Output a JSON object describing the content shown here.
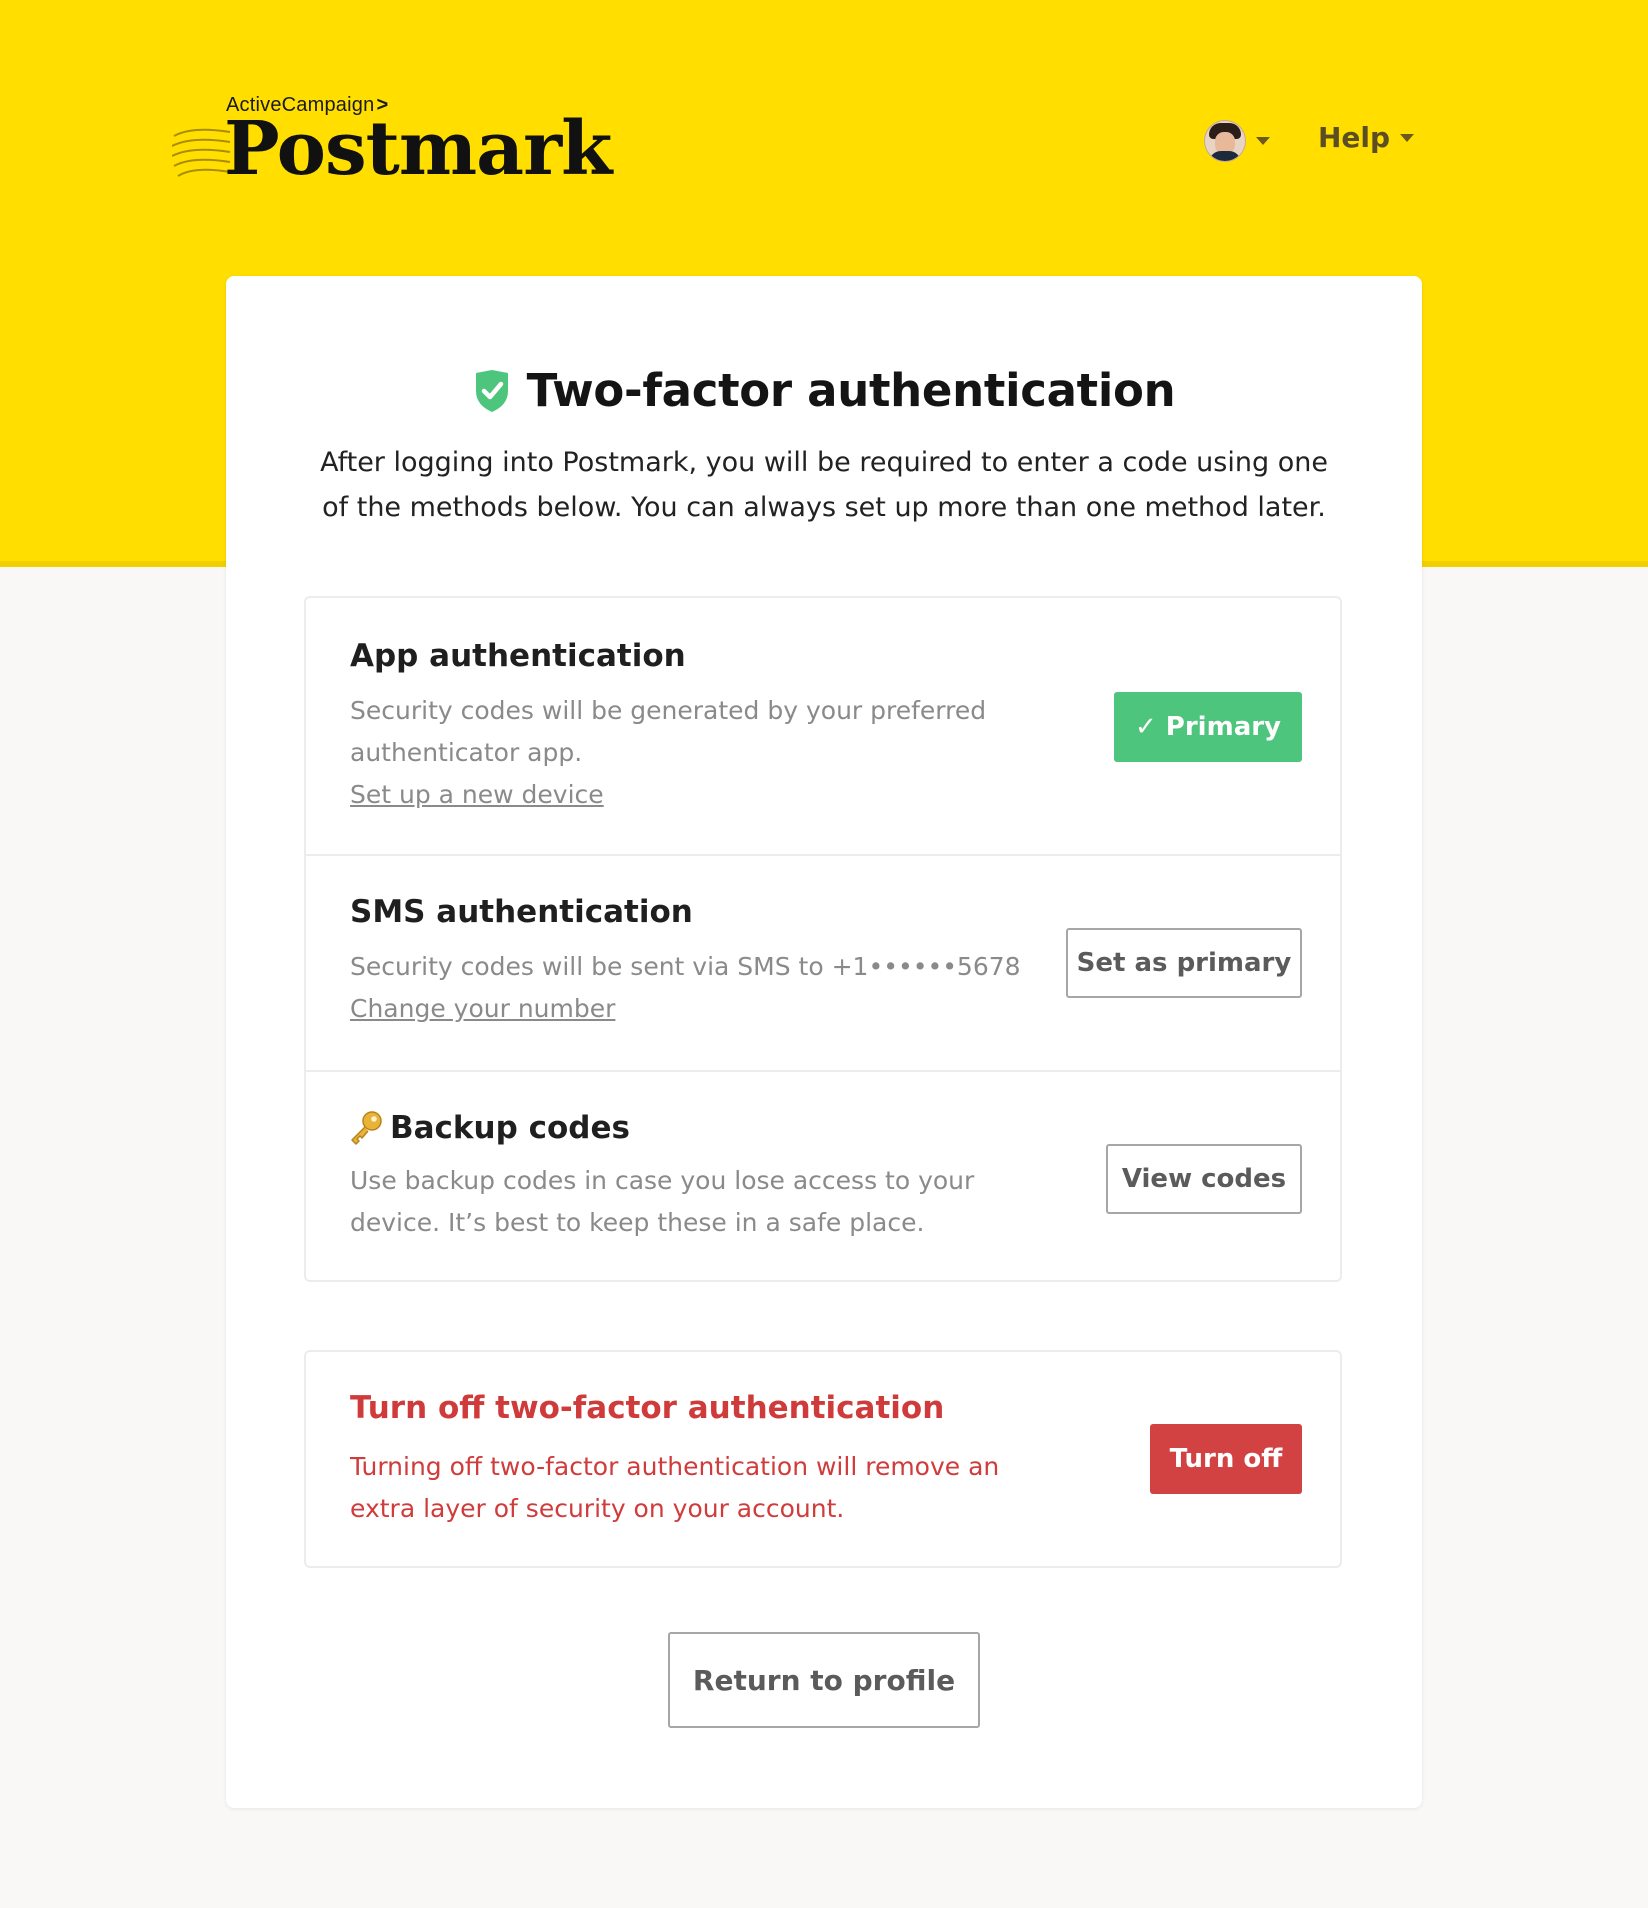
{
  "header": {
    "brand_parent": "ActiveCampaign",
    "brand_chevron": ">",
    "brand_name": "Postmark",
    "help_label": "Help"
  },
  "page": {
    "title": "Two-factor authentication",
    "intro": "After logging into Postmark, you will be required to enter a code using one of the methods below. You can always set up more than one method later."
  },
  "methods": [
    {
      "title": "App authentication",
      "description": "Security codes will be generated by your preferred authenticator app.",
      "link": "Set up a new device",
      "button": "✓ Primary"
    },
    {
      "title": "SMS authentication",
      "description": "Security codes will be sent via SMS to +1••••••5678",
      "link": "Change your number",
      "button": "Set as primary"
    },
    {
      "title": "Backup codes",
      "description": "Use backup codes in case you lose access to your device. It’s best to keep these in a safe place.",
      "button": "View codes"
    }
  ],
  "danger": {
    "title": "Turn off two-factor authentication",
    "description": "Turning off two-factor authentication will remove an extra layer of security on your account.",
    "button": "Turn off"
  },
  "footer": {
    "return_label": "Return to profile"
  },
  "colors": {
    "header_bg": "#ffde00",
    "primary_green": "#4ec57d",
    "danger_red": "#d24242"
  },
  "icons": {
    "shield": "shield-check-icon",
    "key": "key-icon",
    "caret": "chevron-down-icon"
  }
}
